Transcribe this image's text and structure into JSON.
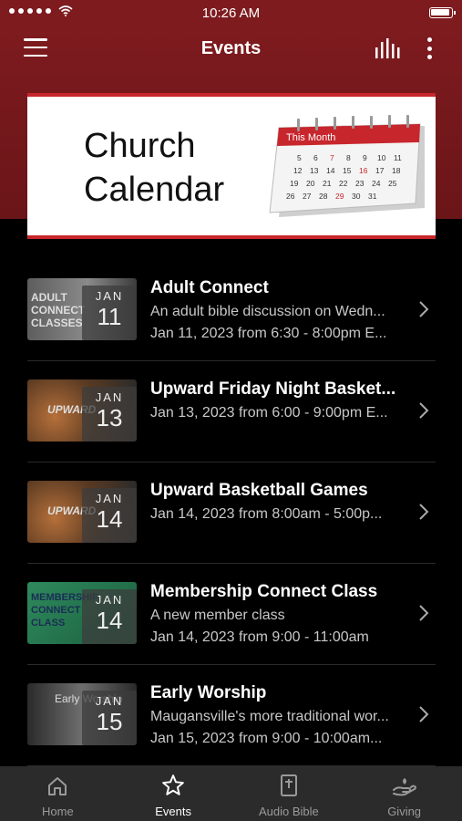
{
  "status_bar": {
    "time": "10:26 AM"
  },
  "nav": {
    "title": "Events"
  },
  "banner": {
    "line1": "Church",
    "line2": "Calendar",
    "calendar_header": "This Month",
    "accent": "#c8262d"
  },
  "events": [
    {
      "thumb_tag": "ADULT CONNECT CLASSES",
      "month": "JAN",
      "day": "11",
      "title": "Adult Connect",
      "desc": "An adult bible discussion on Wedn...",
      "when": "Jan 11, 2023 from 6:30 - 8:00pm E..."
    },
    {
      "thumb_tag": "UPWARD",
      "month": "JAN",
      "day": "13",
      "title": "Upward Friday Night Basket...",
      "desc": "",
      "when": "Jan 13, 2023 from 6:00 - 9:00pm E..."
    },
    {
      "thumb_tag": "UPWARD",
      "month": "JAN",
      "day": "14",
      "title": "Upward Basketball Games",
      "desc": "",
      "when": "Jan 14, 2023 from 8:00am - 5:00p..."
    },
    {
      "thumb_tag": "MEMBERSHIP CONNECT CLASS",
      "month": "JAN",
      "day": "14",
      "title": "Membership Connect Class",
      "desc": "A new member class",
      "when": "Jan 14, 2023 from 9:00 - 11:00am"
    },
    {
      "thumb_tag": "Early Worship",
      "month": "JAN",
      "day": "15",
      "title": "Early Worship",
      "desc": "Maugansville's more traditional wor...",
      "when": "Jan 15, 2023 from 9:00 - 10:00am..."
    }
  ],
  "tabs": [
    {
      "label": "Home",
      "icon": "home-icon"
    },
    {
      "label": "Events",
      "icon": "star-icon"
    },
    {
      "label": "Audio Bible",
      "icon": "bible-icon"
    },
    {
      "label": "Giving",
      "icon": "giving-icon"
    }
  ],
  "colors": {
    "header_bg": "#7e1b1f",
    "tabbar_bg": "#2b2b2b"
  }
}
